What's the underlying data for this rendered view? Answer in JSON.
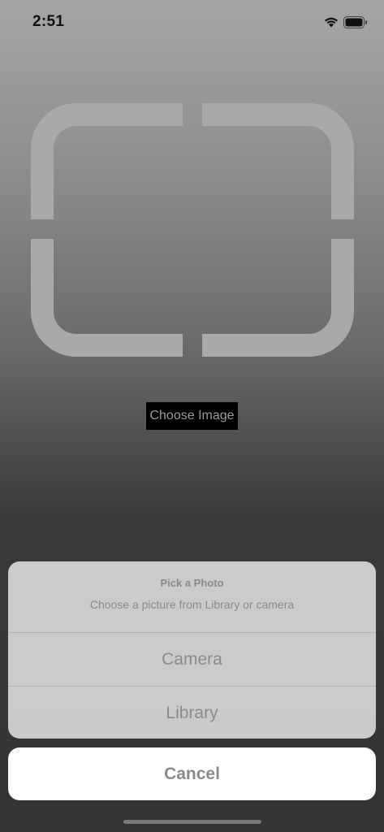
{
  "status_bar": {
    "time": "2:51",
    "icons": [
      "wifi-icon",
      "battery-icon"
    ]
  },
  "main": {
    "placeholder_icon": "image-frame-icon",
    "choose_button_label": "Choose Image"
  },
  "action_sheet": {
    "title": "Pick a Photo",
    "message": "Choose a picture from Library or camera",
    "options": [
      {
        "label": "Camera"
      },
      {
        "label": "Library"
      }
    ],
    "cancel_label": "Cancel"
  },
  "colors": {
    "sheet_background": "#d6d6d6",
    "sheet_text": "#8a8a8a",
    "button_background": "#000000",
    "cancel_background": "#ffffff"
  }
}
